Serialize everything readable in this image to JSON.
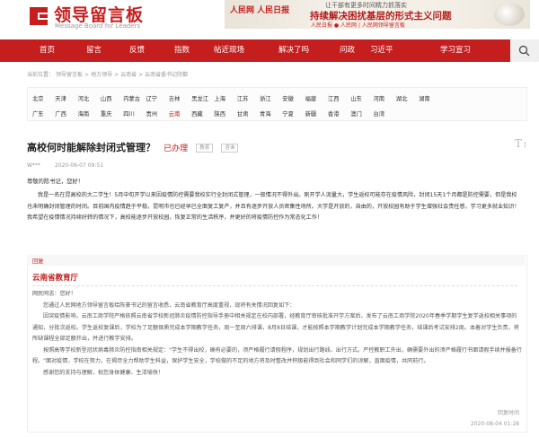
{
  "header": {
    "logo_title": "领导留言板",
    "logo_subtitle": "Message Board for Leaders",
    "banner": {
      "logo_text": "人民网 人民日报",
      "line1": "让干部有更多时间精力抓落实",
      "line2": "持续解决困扰基层的形式主义问题",
      "line3": "人民日报 ● 人民网 | 人民网领导留言板"
    }
  },
  "nav": {
    "items": [
      "首页",
      "留言",
      "反馈",
      "指数",
      "帖近现场",
      "解决了吗",
      "问政",
      "习近平",
      "学习宣习"
    ]
  },
  "breadcrumb": {
    "items": [
      "当前位置：",
      "领导留言板",
      ">",
      "地方领导",
      ">",
      "云南省",
      ">",
      "云南省委书记院都"
    ]
  },
  "regions": {
    "row1": [
      "北京",
      "天津",
      "河北",
      "山西",
      "内蒙古",
      "辽宁",
      "吉林",
      "黑龙江",
      "上海",
      "江苏",
      "浙江",
      "安徽",
      "福建",
      "江西",
      "山东",
      "河南",
      "湖北",
      "湖南"
    ],
    "row2": [
      "广东",
      "广西",
      "海南",
      "重庆",
      "四川",
      "贵州",
      "云南",
      "西藏",
      "陕西",
      "甘肃",
      "青海",
      "宁夏",
      "新疆",
      "香港",
      "澳门",
      "台湾"
    ],
    "active": "云南"
  },
  "message": {
    "title": "高校何时能解除封闭式管理？",
    "status": "已办理",
    "tags": [
      "教育",
      "咨询"
    ],
    "user": "W***",
    "date": "2020-06-07 09:51",
    "greeting": "尊敬的陈书记，您好！",
    "body": "我是一名在昆高校的大二学生！5月中旬开学以来因疫情防控需要我校实行全封闭式管理，一般情况不得外出。刚开学人流量大，学生返校可能存在疫情风险，封闭15天1个月都是防控需要，但是我校也未明确封闭管理的时间。目前国内疫情趋于平稳，昆明市也已经早已全面复工复产，并且有逐步开放人员密集性场所。大学是开放的，自由的，开放校园有助于学生增强社会责任感，学习更多就业知识！我希望在疫情情况持续好转的情况下，高校能逐步开放校园，恢复正常的生活秩序，并更好的将疫情防控作为常态化工作！"
  },
  "reply": {
    "label": "回复",
    "from": "云南省教育厅",
    "paragraphs": [
      "网民同志：您好！",
      "您通过人民网地方领导留言板给陈豪书记的留言收悉，云南省教育厅高度重视，现将有关情况回复如下：",
      "因突疫情影响，云南工商学院严格依照云南省学校新冠肺炎疫情防控指导手册中相关规定在校内部署，经教育厅审核批准开学方案后，发布了云南工商学院2020年春季学期学生复学返校相关事项的通知，分批次返校。学生返校复课后，学校为了足额保质完成本学期教学任务，周一至周六排课，8月8日结课，才能按照本学期教学计划完成本学期教学任务，结课后考试安排2周。本着对学生负责，将所缺课程全部足额开出，并进行教学安排。",
      "按照高等学校新型冠状病毒肺炎防控指南相关规定：\"学生不得出校，确有必要的，须严格履行请假程序，规划出行路线、出行方式。严控教职工外出，确需要外出的须严格履行书面请假手续并报备行程。\"面对疫情，学校在努力，在揭尽全力帮助学生科益，保护学生安全，学校做的不足的地方将及时整改并积极能得到社会和同学们的谅解，直面疫情，共同前行。",
      "感谢您的支持与理解，祝您身体健康、生活愉快！"
    ],
    "sign": "回复时间",
    "date": "2020-08-04 01:28"
  }
}
